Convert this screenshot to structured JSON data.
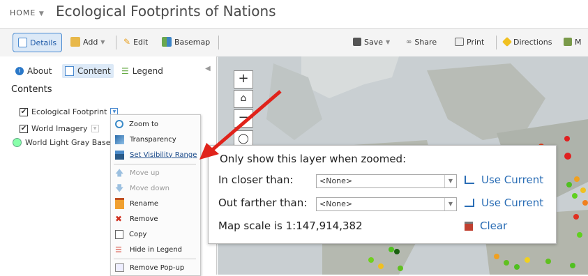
{
  "header": {
    "home_label": "HOME",
    "title": "Ecological Footprints of Nations"
  },
  "toolbar": {
    "details": "Details",
    "add": "Add",
    "edit": "Edit",
    "basemap": "Basemap",
    "save": "Save",
    "share": "Share",
    "print": "Print",
    "directions": "Directions",
    "more": "M"
  },
  "panel": {
    "tabs": {
      "about": "About",
      "content": "Content",
      "legend": "Legend"
    },
    "heading": "Contents",
    "layers": [
      {
        "label": "Ecological Footprint",
        "checked": true
      },
      {
        "label": "World Imagery",
        "checked": true
      },
      {
        "label": "World Light Gray Base"
      }
    ]
  },
  "context_menu": {
    "items": [
      {
        "label": "Zoom to",
        "icon": "zoom-to-icon"
      },
      {
        "label": "Transparency",
        "icon": "transparency-icon"
      },
      {
        "label": "Set Visibility Range",
        "icon": "visibility-range-icon"
      },
      {
        "label": "Move up",
        "icon": "arrow-up-icon",
        "disabled": true
      },
      {
        "label": "Move down",
        "icon": "arrow-down-icon",
        "disabled": true
      },
      {
        "label": "Rename",
        "icon": "rename-icon"
      },
      {
        "label": "Remove",
        "icon": "remove-icon"
      },
      {
        "label": "Copy",
        "icon": "copy-icon"
      },
      {
        "label": "Hide in Legend",
        "icon": "hide-legend-icon"
      },
      {
        "label": "Remove Pop-up",
        "icon": "remove-popup-icon"
      }
    ]
  },
  "map": {
    "zoom_in": "+",
    "zoom_out": "−"
  },
  "visibility_dialog": {
    "title": "Only show this layer when zoomed:",
    "closer_label": "In closer than:",
    "closer_value": "<None>",
    "farther_label": "Out farther than:",
    "farther_value": "<None>",
    "use_current": "Use Current",
    "scale_text": "Map scale is 1:147,914,382",
    "clear": "Clear"
  },
  "colors": {
    "accent": "#2a6db5",
    "arrow": "#e0231b",
    "map_bg": "#c9cfd2"
  }
}
